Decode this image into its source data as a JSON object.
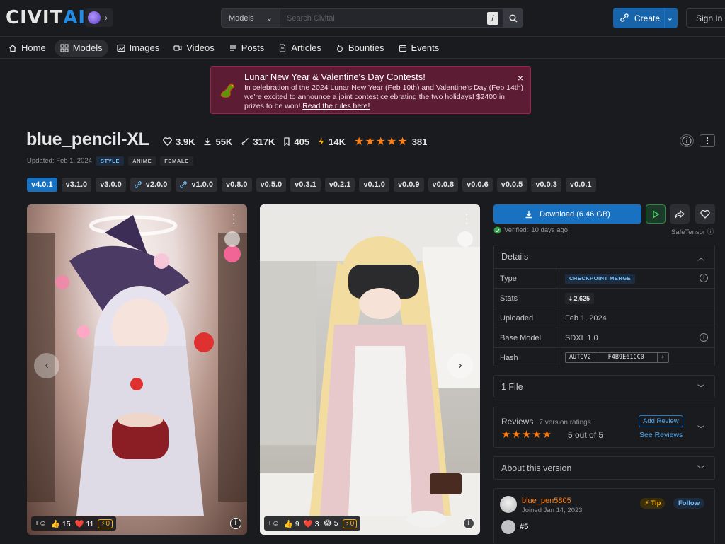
{
  "header": {
    "logo": "CIVITAI",
    "search_type": "Models",
    "search_placeholder": "Search Civitai",
    "search_shortcut": "/",
    "create_label": "Create",
    "signin_label": "Sign In"
  },
  "nav": {
    "items": [
      {
        "label": "Home",
        "icon": "home-icon"
      },
      {
        "label": "Models",
        "icon": "grid-icon"
      },
      {
        "label": "Images",
        "icon": "image-icon"
      },
      {
        "label": "Videos",
        "icon": "video-icon"
      },
      {
        "label": "Posts",
        "icon": "posts-icon"
      },
      {
        "label": "Articles",
        "icon": "article-icon"
      },
      {
        "label": "Bounties",
        "icon": "bounty-icon"
      },
      {
        "label": "Events",
        "icon": "calendar-icon"
      }
    ]
  },
  "banner": {
    "title": "Lunar New Year & Valentine's Day Contests!",
    "text": "In celebration of the 2024 Lunar New Year (Feb 10th) and Valentine's Day (Feb 14th) we're excited to announce a joint contest celebrating the two holidays! $2400 in prizes to be won! ",
    "link": "Read the rules here!"
  },
  "model": {
    "title": "blue_pencil-XL",
    "likes": "3.9K",
    "downloads": "55K",
    "generations": "317K",
    "collected": "405",
    "buzz": "14K",
    "rating_count": "381",
    "updated": "Updated: Feb 1, 2024",
    "tags": [
      "STYLE",
      "ANIME",
      "FEMALE"
    ]
  },
  "versions": [
    {
      "label": "v4.0.1",
      "active": true,
      "linked": false
    },
    {
      "label": "v3.1.0",
      "active": false,
      "linked": false
    },
    {
      "label": "v3.0.0",
      "active": false,
      "linked": false
    },
    {
      "label": "v2.0.0",
      "active": false,
      "linked": true
    },
    {
      "label": "v1.0.0",
      "active": false,
      "linked": true
    },
    {
      "label": "v0.8.0",
      "active": false,
      "linked": false
    },
    {
      "label": "v0.5.0",
      "active": false,
      "linked": false
    },
    {
      "label": "v0.3.1",
      "active": false,
      "linked": false
    },
    {
      "label": "v0.2.1",
      "active": false,
      "linked": false
    },
    {
      "label": "v0.1.0",
      "active": false,
      "linked": false
    },
    {
      "label": "v0.0.9",
      "active": false,
      "linked": false
    },
    {
      "label": "v0.0.8",
      "active": false,
      "linked": false
    },
    {
      "label": "v0.0.6",
      "active": false,
      "linked": false
    },
    {
      "label": "v0.0.5",
      "active": false,
      "linked": false
    },
    {
      "label": "v0.0.3",
      "active": false,
      "linked": false
    },
    {
      "label": "v0.0.1",
      "active": false,
      "linked": false
    }
  ],
  "gallery": [
    {
      "reactions": {
        "like": "15",
        "heart": "11",
        "buzz": "0"
      }
    },
    {
      "reactions": {
        "like": "9",
        "heart": "3",
        "laugh": "5",
        "buzz": "0"
      }
    }
  ],
  "download": {
    "label": "Download (6.46 GB)",
    "verified_prefix": "Verified:",
    "verified_when": "10 days ago",
    "format": "SafeTensor"
  },
  "details": {
    "title": "Details",
    "rows": {
      "type_key": "Type",
      "type_val": "CHECKPOINT MERGE",
      "stats_key": "Stats",
      "stats_val": "2,625",
      "uploaded_key": "Uploaded",
      "uploaded_val": "Feb 1, 2024",
      "base_key": "Base Model",
      "base_val": "SDXL 1.0",
      "hash_key": "Hash",
      "hash_type": "AUTOV2",
      "hash_val": "F4B9E61CC0"
    }
  },
  "files": {
    "label": "1 File"
  },
  "reviews": {
    "title": "Reviews",
    "count": "7 version ratings",
    "score": "5 out of 5",
    "add": "Add Review",
    "see": "See Reviews"
  },
  "about": {
    "label": "About this version"
  },
  "author": {
    "name": "blue_pen5805",
    "joined": "Joined Jan 14, 2023",
    "tip": "Tip",
    "follow": "Follow",
    "rank": "#5"
  }
}
